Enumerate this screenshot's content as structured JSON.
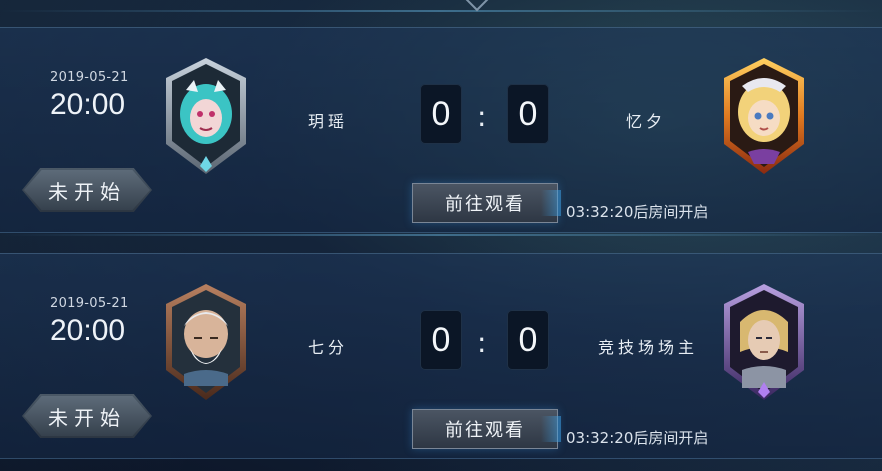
{
  "matches": [
    {
      "date": "2019-05-21",
      "time": "20:00",
      "status": "未开始",
      "left_player": "玥瑶",
      "right_player": "忆夕",
      "left_score": "0",
      "right_score": "0",
      "separator": ":",
      "watch_label": "前往观看",
      "countdown": "03:32:20后房间开启",
      "left_avatar_icon": "hero-portrait-teal-hair-icon",
      "right_avatar_icon": "hero-portrait-blonde-helmet-icon"
    },
    {
      "date": "2019-05-21",
      "time": "20:00",
      "status": "未开始",
      "left_player": "七分",
      "right_player": "竞技场场主",
      "left_score": "0",
      "right_score": "0",
      "separator": ":",
      "watch_label": "前往观看",
      "countdown": "03:32:20后房间开启",
      "left_avatar_icon": "hero-portrait-old-man-icon",
      "right_avatar_icon": "hero-portrait-blonde-knight-icon"
    }
  ],
  "colors": {
    "background": "#14243a",
    "score_box": "#0b1626",
    "accent_glow": "#3ca0e6",
    "frame_silver": "#9aa8b6",
    "frame_gold": "#d98a2a",
    "frame_bronze": "#8a5a3c",
    "frame_purple": "#6a4a9a"
  }
}
